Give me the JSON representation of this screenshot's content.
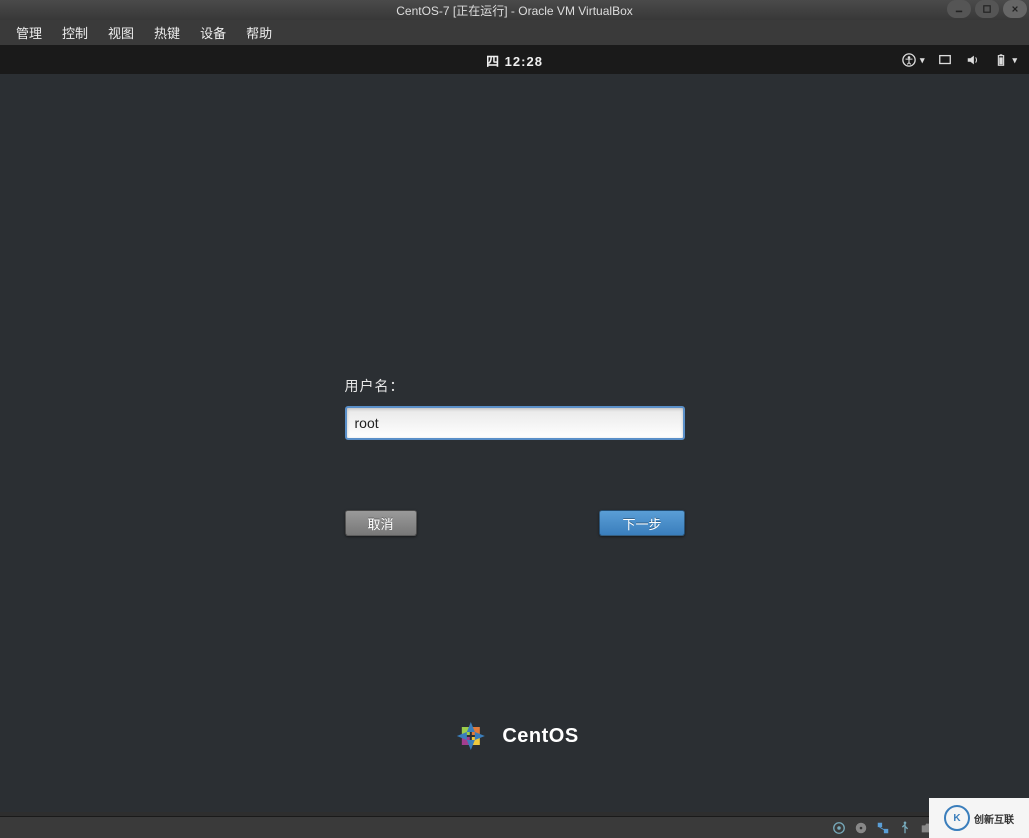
{
  "vbox": {
    "title": "CentOS-7 [正在运行] - Oracle VM VirtualBox",
    "menu": [
      "管理",
      "控制",
      "视图",
      "热键",
      "设备",
      "帮助"
    ]
  },
  "gnome": {
    "clock": "四 12:28",
    "accessibility_icon": "accessibility",
    "screen_icon": "screen",
    "volume_icon": "volume",
    "battery_icon": "battery"
  },
  "login": {
    "username_label": "用户名：",
    "username_value": "root",
    "cancel_label": "取消",
    "next_label": "下一步"
  },
  "centos": {
    "brand": "CentOS"
  },
  "watermark": {
    "text": "创新互联"
  }
}
